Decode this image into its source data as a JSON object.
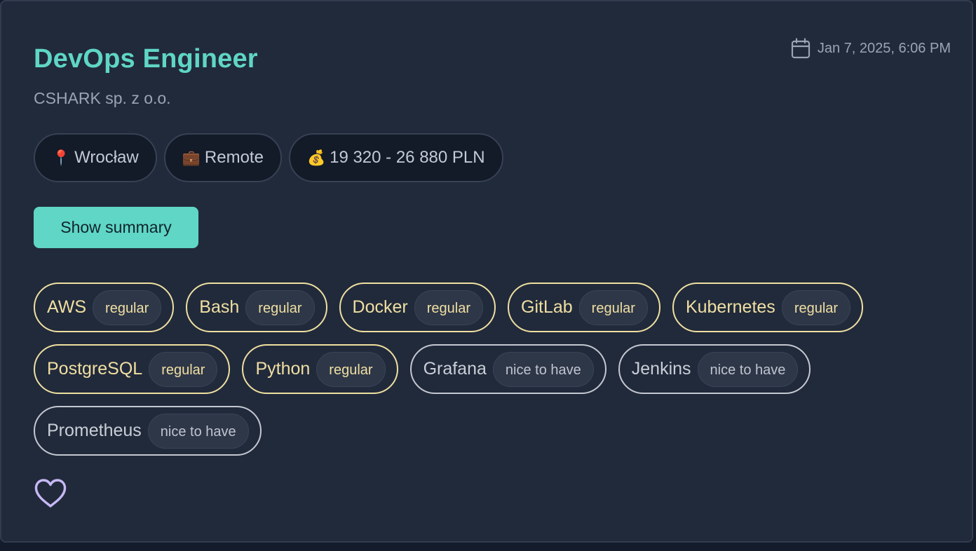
{
  "job": {
    "title": "DevOps Engineer",
    "company": "CSHARK sp. z o.o.",
    "posted": "Jan 7, 2025, 6:06 PM",
    "location": "Wrocław",
    "work_mode": "Remote",
    "salary": "19 320 - 26 880 PLN"
  },
  "icons": {
    "calendar": "calendar-icon",
    "location": "📍",
    "work_mode": "💼",
    "salary": "💰",
    "favorite": "heart-outline-icon"
  },
  "actions": {
    "summary_label": "Show summary"
  },
  "skills": [
    {
      "name": "AWS",
      "level": "regular"
    },
    {
      "name": "Bash",
      "level": "regular"
    },
    {
      "name": "Docker",
      "level": "regular"
    },
    {
      "name": "GitLab",
      "level": "regular"
    },
    {
      "name": "Kubernetes",
      "level": "regular"
    },
    {
      "name": "PostgreSQL",
      "level": "regular"
    },
    {
      "name": "Python",
      "level": "regular"
    },
    {
      "name": "Grafana",
      "level": "nice to have"
    },
    {
      "name": "Jenkins",
      "level": "nice to have"
    },
    {
      "name": "Prometheus",
      "level": "nice to have"
    }
  ],
  "colors": {
    "accent": "#5fd6c6",
    "card_background": "#212a3b",
    "regular_skill": "#f0dfa2",
    "nice_to_have_skill": "#c4c8d0",
    "favorite_icon": "#c7b8f5"
  }
}
